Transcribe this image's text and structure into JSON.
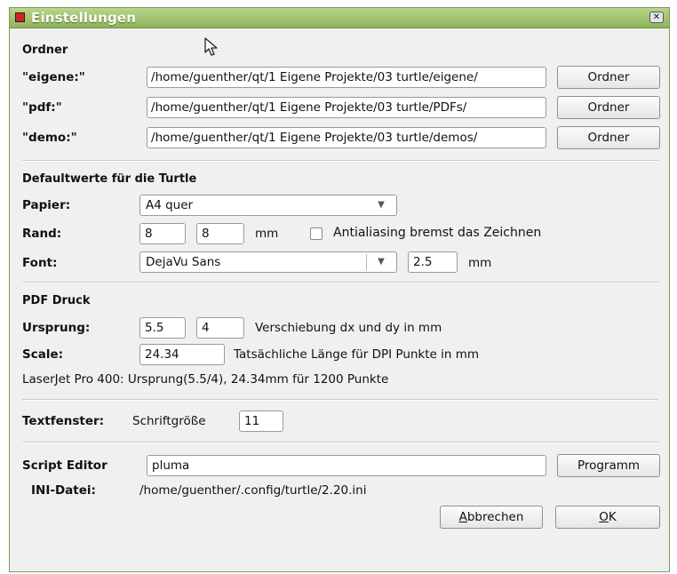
{
  "window": {
    "title": "Einstellungen",
    "close_glyph": "✕"
  },
  "ordner": {
    "section_title": "Ordner",
    "rows": [
      {
        "label": "\"eigene:\"",
        "path": "/home/guenther/qt/1 Eigene Projekte/03 turtle/eigene/",
        "button": "Ordner"
      },
      {
        "label": "\"pdf:\"",
        "path": "/home/guenther/qt/1 Eigene Projekte/03 turtle/PDFs/",
        "button": "Ordner"
      },
      {
        "label": "\"demo:\"",
        "path": "/home/guenther/qt/1 Eigene Projekte/03 turtle/demos/",
        "button": "Ordner"
      }
    ]
  },
  "defaults": {
    "section_title": "Defaultwerte für die Turtle",
    "papier_label": "Papier:",
    "papier_value": "A4 quer",
    "rand_label": "Rand:",
    "rand_x": "8",
    "rand_y": "8",
    "rand_unit": "mm",
    "antialiasing_label": "Antialiasing bremst das Zeichnen",
    "antialiasing_checked": false,
    "font_label": "Font:",
    "font_value": "DejaVu Sans",
    "font_size": "2.5",
    "font_unit": "mm"
  },
  "pdf": {
    "section_title": "PDF Druck",
    "ursprung_label": "Ursprung:",
    "ursprung_x": "5.5",
    "ursprung_y": "4",
    "ursprung_desc": "Verschiebung dx und dy in mm",
    "scale_label": "Scale:",
    "scale_value": "24.34",
    "scale_desc": "Tatsächliche Länge für DPI Punkte in mm",
    "printer_note": "LaserJet Pro 400:  Ursprung(5.5/4), 24.34mm für 1200 Punkte"
  },
  "textfenster": {
    "label": "Textfenster:",
    "desc": "Schriftgröße",
    "value": "11"
  },
  "script": {
    "label": "Script Editor",
    "value": "pluma",
    "button": "Programm",
    "ini_label": "INI-Datei:",
    "ini_path": "/home/guenther/.config/turtle/2.20.ini"
  },
  "buttons": {
    "cancel_pre": "",
    "cancel_ul": "A",
    "cancel_post": "bbrechen",
    "ok_ul": "O",
    "ok_post": "K"
  }
}
